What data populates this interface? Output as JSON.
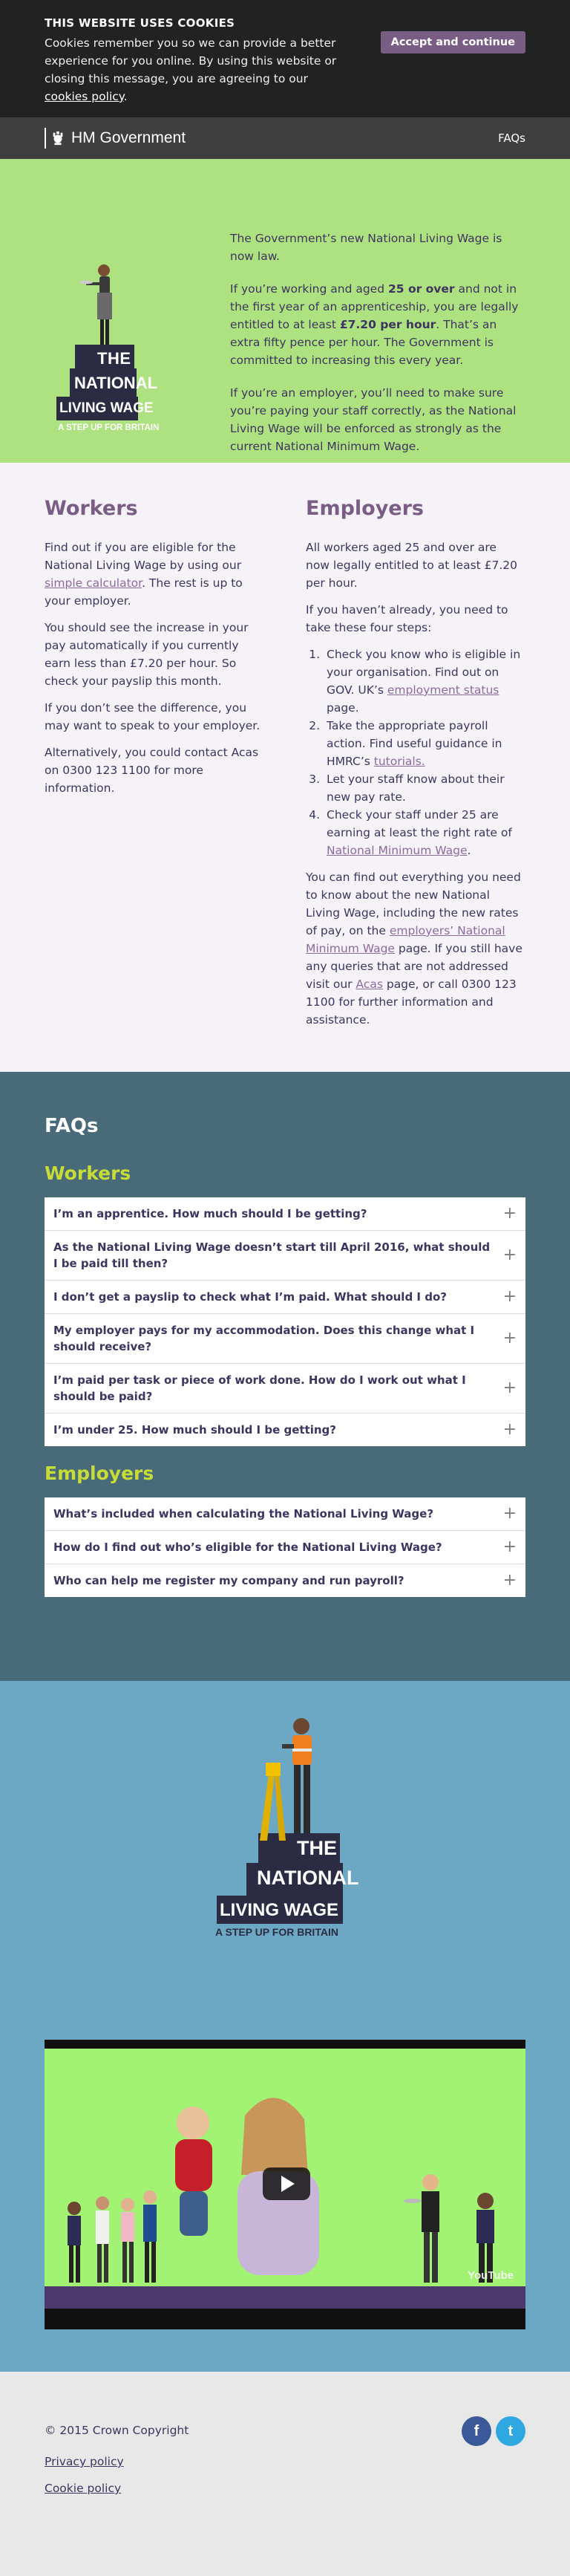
{
  "cookie": {
    "heading": "THIS WEBSITE USES COOKIES",
    "text": "Cookies remember you so we can provide a better experience for you online. By using this website or closing this message, you are agreeing to our ",
    "link": "cookies policy",
    "end": ".",
    "accept": "Accept and continue"
  },
  "govbar": {
    "logo_text": "HM Government",
    "faqs_link": "FAQs"
  },
  "logo_art": {
    "line1": "THE",
    "line2": "NATIONAL",
    "line3": "LIVING WAGE",
    "tagline": "A STEP UP FOR BRITAIN"
  },
  "hero": {
    "p1": "The Government’s new National Living Wage is now law.",
    "p2a": "If you’re working and aged ",
    "p2b": "25 or over",
    "p2c": " and not in the first year of an apprenticeship, you are legally entitled to at least ",
    "p2d": "£7.20 per hour",
    "p2e": ". That’s an extra fifty pence per hour. The Government is committed to increasing this every year.",
    "p3": "If you’re an employer, you’ll need to make sure you’re paying your staff correctly, as the National Living Wage will be enforced as strongly as the current National Minimum Wage."
  },
  "workers": {
    "heading": "Workers",
    "p1a": "Find out if you are eligible for the National Living Wage by using our ",
    "p1link": "simple calculator",
    "p1b": ". The rest is up to your employer.",
    "p2": "You should see the increase in your pay automatically if you currently earn less than £7.20 per hour. So check your payslip this month.",
    "p3": "If you don’t see the difference, you may want to speak to your employer.",
    "p4": "Alternatively, you could contact Acas on 0300 123 1100 for more information."
  },
  "employers": {
    "heading": "Employers",
    "p1": "All workers aged 25 and over are now legally entitled to at least £7.20 per hour.",
    "p2": "If you haven’t already, you need to take these four steps:",
    "step1a": "Check you know who is eligible in your organisation. Find out on GOV. UK’s ",
    "step1link": "employment status",
    "step1b": " page.",
    "step2a": "Take the appropriate payroll action. Find useful guidance in HMRC’s ",
    "step2link": "tutorials.",
    "step3": "Let your staff know about their new pay rate.",
    "step4a": "Check your staff under 25 are earning at least the right rate of ",
    "step4link": "National Minimum Wage",
    "step4b": ".",
    "p3a": "You can find out everything you need to know about the new National Living Wage, including the new rates of pay, on the ",
    "p3link": "employers’ National Minimum Wage",
    "p3b": " page. If you still have any queries that are not addressed visit our ",
    "p3link2": "Acas",
    "p3c": " page, or call 0300 123 1100 for further information and assistance."
  },
  "faqs": {
    "title": "FAQs",
    "workers_heading": "Workers",
    "workers_questions": [
      "I’m an apprentice. How much should I be getting?",
      "As the National Living Wage doesn’t start till April 2016, what should I be paid till then?",
      "I don’t get a payslip to check what I’m paid. What should I do?",
      "My employer pays for my accommodation. Does this change what I should receive?",
      "I’m paid per task or piece of work done. How do I work out what I should be paid?",
      "I’m under 25. How much should I be getting?"
    ],
    "employers_heading": "Employers",
    "employers_questions": [
      "What’s included when calculating the National Living Wage?",
      "How do I find out who’s eligible for the National Living Wage?",
      "Who can help me register my company and run payroll?"
    ],
    "plus": "+"
  },
  "video": {
    "brand": "YouTube"
  },
  "footer": {
    "copyright": "© 2015 Crown Copyright",
    "privacy": "Privacy policy",
    "cookie": "Cookie policy",
    "facebook": "f",
    "twitter": "t"
  },
  "colors": {
    "hero_bg": "#aee17f",
    "faq_bg": "#496b79",
    "accent_yellow": "#c8dc38",
    "purple": "#7a5d84",
    "video_bg": "#6ca8c4"
  }
}
